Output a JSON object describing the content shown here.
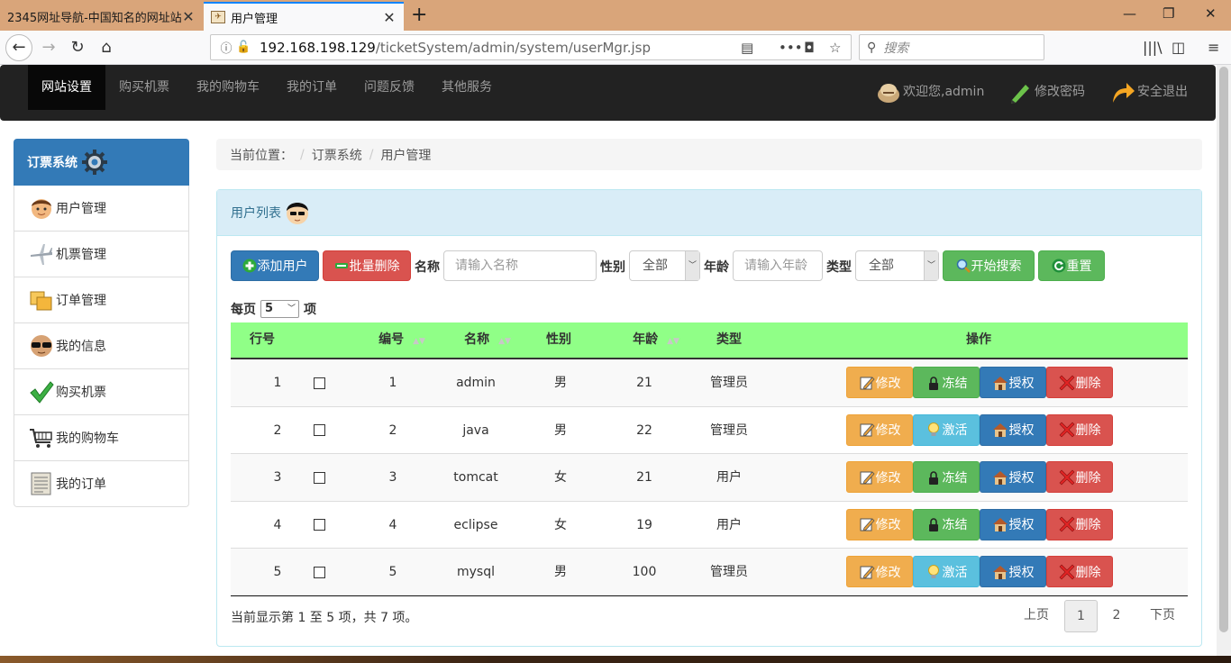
{
  "browser": {
    "tabs": [
      {
        "title": "2345网址导航-中国知名的网址站",
        "close": "✕"
      },
      {
        "title": "用户管理",
        "close": "✕"
      }
    ],
    "new_tab": "+",
    "url_host": "192.168.198.129",
    "url_path": "/ticketSystem/admin/system/userMgr.jsp",
    "search_placeholder": "搜索"
  },
  "site_nav": {
    "items": [
      "网站设置",
      "购买机票",
      "我的购物车",
      "我的订单",
      "问题反馈",
      "其他服务"
    ],
    "welcome": "欢迎您,admin",
    "change_password": "修改密码",
    "logout": "安全退出"
  },
  "sidebar": {
    "title": "订票系统",
    "items": [
      "用户管理",
      "机票管理",
      "订单管理",
      "我的信息",
      "购买机票",
      "我的购物车",
      "我的订单"
    ]
  },
  "breadcrumb": {
    "label": "当前位置：",
    "sep": "/",
    "items": [
      "订票系统",
      "用户管理"
    ]
  },
  "panel": {
    "title": "用户列表",
    "add_button": "添加用户",
    "batch_delete_button": "批量删除",
    "name_label": "名称",
    "name_placeholder": "请输入名称",
    "gender_label": "性别",
    "gender_value": "全部",
    "age_label": "年龄",
    "age_placeholder": "请输入年龄",
    "type_label": "类型",
    "type_value": "全部",
    "search_button": "开始搜索",
    "reset_button": "重置",
    "per_page_prefix": "每页",
    "per_page_value": "5",
    "per_page_suffix": "项"
  },
  "table": {
    "headers": [
      "行号",
      "编号",
      "名称",
      "性别",
      "年龄",
      "类型",
      "操作"
    ],
    "rows": [
      {
        "row": "1",
        "id": "1",
        "name": "admin",
        "gender": "男",
        "age": "21",
        "type": "管理员",
        "toggle": "冻结"
      },
      {
        "row": "2",
        "id": "2",
        "name": "java",
        "gender": "男",
        "age": "22",
        "type": "管理员",
        "toggle": "激活"
      },
      {
        "row": "3",
        "id": "3",
        "name": "tomcat",
        "gender": "女",
        "age": "21",
        "type": "用户",
        "toggle": "冻结"
      },
      {
        "row": "4",
        "id": "4",
        "name": "eclipse",
        "gender": "女",
        "age": "19",
        "type": "用户",
        "toggle": "冻结"
      },
      {
        "row": "5",
        "id": "5",
        "name": "mysql",
        "gender": "男",
        "age": "100",
        "type": "管理员",
        "toggle": "激活"
      }
    ],
    "action_edit": "修改",
    "action_auth": "授权",
    "action_delete": "删除"
  },
  "footer": {
    "info": "当前显示第 1 至 5 项，共 7 项。",
    "prev": "上页",
    "pages": [
      "1",
      "2"
    ],
    "next": "下页"
  },
  "colors": {
    "primary": "#337ab7",
    "danger": "#d9534f",
    "success": "#5cb85c",
    "warning": "#f0ad4e",
    "info": "#5bc0de",
    "table_header": "#90ff87",
    "nav_bg": "#222222"
  }
}
